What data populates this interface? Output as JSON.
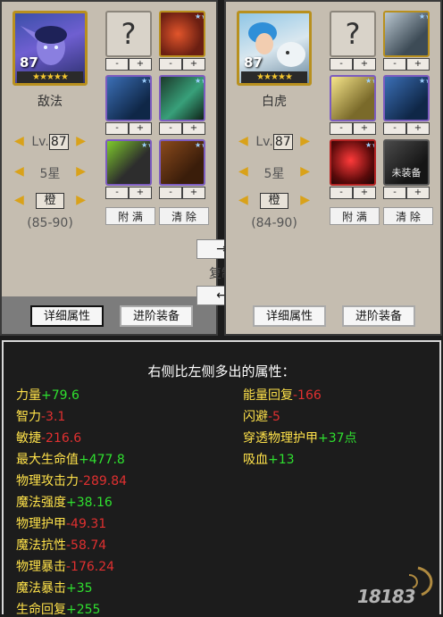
{
  "left": {
    "hero_name": "敌法",
    "hero_level": "87",
    "hero_stars": "★★★★★",
    "lv_prefix": "Lv.",
    "lv_value": "87",
    "star_level": "5星",
    "quality": "橙",
    "range": "(85-90)",
    "fill_btn": "附 满",
    "clear_btn": "清 除",
    "detail_btn": "详细属性",
    "advance_btn": "进阶装备"
  },
  "right": {
    "hero_name": "白虎",
    "hero_level": "87",
    "hero_stars": "★★★★★",
    "lv_prefix": "Lv.",
    "lv_value": "87",
    "star_level": "5星",
    "quality": "橙",
    "range": "(84-90)",
    "fill_btn": "附 满",
    "clear_btn": "清 除",
    "detail_btn": "详细属性",
    "advance_btn": "进阶装备",
    "unequipped_label": "未装备"
  },
  "slot_controls": {
    "minus": "-",
    "plus": "+",
    "empty_mark": "?",
    "side_stars": "★★★★★"
  },
  "arrows": {
    "left": "◀",
    "right": "▶"
  },
  "middle": {
    "to_right": "→",
    "copy_label": "复制",
    "to_left": "←"
  },
  "compare": {
    "title": "右侧比左侧多出的属性：",
    "left_column": [
      {
        "name": "力量",
        "value": "+79.6",
        "sign": "pos"
      },
      {
        "name": "智力",
        "value": "-3.1",
        "sign": "neg"
      },
      {
        "name": "敏捷",
        "value": "-216.6",
        "sign": "neg"
      },
      {
        "name": "最大生命值",
        "value": "+477.8",
        "sign": "pos"
      },
      {
        "name": "物理攻击力",
        "value": "-289.84",
        "sign": "neg"
      },
      {
        "name": "魔法强度",
        "value": "+38.16",
        "sign": "pos"
      },
      {
        "name": "物理护甲",
        "value": "-49.31",
        "sign": "neg"
      },
      {
        "name": "魔法抗性",
        "value": "-58.74",
        "sign": "neg"
      },
      {
        "name": "物理暴击",
        "value": "-176.24",
        "sign": "neg"
      },
      {
        "name": "魔法暴击",
        "value": "+35",
        "sign": "pos"
      },
      {
        "name": "生命回复",
        "value": "+255",
        "sign": "pos"
      }
    ],
    "right_column": [
      {
        "name": "能量回复",
        "value": "-166",
        "sign": "neg"
      },
      {
        "name": "闪避",
        "value": "-5",
        "sign": "neg"
      },
      {
        "name": "穿透物理护甲",
        "value": "+37点",
        "sign": "pos"
      },
      {
        "name": "吸血",
        "value": "+13",
        "sign": "pos"
      }
    ]
  },
  "colors": {
    "positive": "#2fe02f",
    "negative": "#e03030",
    "label": "#ffe24a"
  },
  "watermark": "18183"
}
